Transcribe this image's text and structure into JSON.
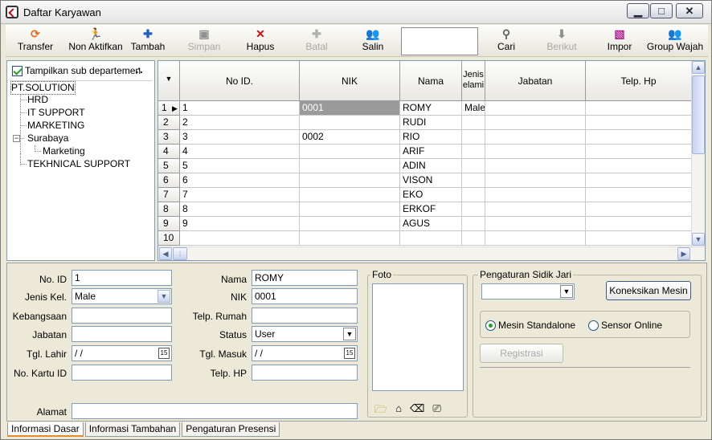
{
  "window": {
    "title": "Daftar Karyawan",
    "minimize": "▁",
    "maximize": "□",
    "close": "✕"
  },
  "toolbar": {
    "buttons": [
      {
        "label": "Transfer",
        "icon": "refresh-icon",
        "glyph": "⟳",
        "color": "#e07020",
        "enabled": true
      },
      {
        "label": "Non Aktifkan",
        "icon": "person-run-icon",
        "glyph": "🏃",
        "color": "#c03030",
        "enabled": true
      },
      {
        "label": "Tambah",
        "icon": "plus-icon",
        "glyph": "✚",
        "color": "#1f5fbf",
        "enabled": true
      },
      {
        "label": "Simpan",
        "icon": "save-icon",
        "glyph": "▣",
        "color": "#909090",
        "enabled": false
      },
      {
        "label": "Hapus",
        "icon": "delete-x-icon",
        "glyph": "✕",
        "color": "#d01010",
        "enabled": true
      },
      {
        "label": "Batal",
        "icon": "cancel-plus-icon",
        "glyph": "✚",
        "color": "#b0b0b0",
        "enabled": false
      },
      {
        "label": "Salin",
        "icon": "people-icon",
        "glyph": "👥",
        "color": "#c0a000",
        "enabled": true
      },
      {
        "label": "Cari",
        "icon": "search-bulb-icon",
        "glyph": "⚲",
        "color": "#606060",
        "enabled": true
      },
      {
        "label": "Berikut",
        "icon": "arrow-down-icon",
        "glyph": "⬇",
        "color": "#909090",
        "enabled": false
      },
      {
        "label": "Impor",
        "icon": "import-icon",
        "glyph": "▧",
        "color": "#b02090",
        "enabled": true
      },
      {
        "label": "Group Wajah",
        "icon": "group-face-icon",
        "glyph": "👥",
        "color": "#c0a000",
        "enabled": true
      }
    ],
    "search_value": ""
  },
  "tree": {
    "show_sub_label": "Tampilkan sub departemen",
    "show_sub_checked": true,
    "nodes": [
      {
        "label": "PT.SOLUTION"
      },
      {
        "label": "HRD"
      },
      {
        "label": "IT SUPPORT"
      },
      {
        "label": "MARKETING"
      },
      {
        "label": "Surabaya"
      },
      {
        "label": "Marketing"
      },
      {
        "label": "TEKHNICAL SUPPORT"
      }
    ]
  },
  "grid": {
    "columns": [
      "No ID.",
      "NIK",
      "Nama",
      "Jenis elami",
      "Jabatan",
      "Telp. Hp"
    ],
    "rows": [
      {
        "row": "1",
        "no_id": "1",
        "nik": "0001",
        "nama": "ROMY",
        "jenis": "Male",
        "jabatan": "",
        "telp": ""
      },
      {
        "row": "2",
        "no_id": "2",
        "nik": "",
        "nama": "RUDI",
        "jenis": "",
        "jabatan": "",
        "telp": ""
      },
      {
        "row": "3",
        "no_id": "3",
        "nik": "0002",
        "nama": "RIO",
        "jenis": "",
        "jabatan": "",
        "telp": ""
      },
      {
        "row": "4",
        "no_id": "4",
        "nik": "",
        "nama": "ARIF",
        "jenis": "",
        "jabatan": "",
        "telp": ""
      },
      {
        "row": "5",
        "no_id": "5",
        "nik": "",
        "nama": "ADIN",
        "jenis": "",
        "jabatan": "",
        "telp": ""
      },
      {
        "row": "6",
        "no_id": "6",
        "nik": "",
        "nama": "VISON",
        "jenis": "",
        "jabatan": "",
        "telp": ""
      },
      {
        "row": "7",
        "no_id": "7",
        "nik": "",
        "nama": "EKO",
        "jenis": "",
        "jabatan": "",
        "telp": ""
      },
      {
        "row": "8",
        "no_id": "8",
        "nik": "",
        "nama": "ERKOF",
        "jenis": "",
        "jabatan": "",
        "telp": ""
      },
      {
        "row": "9",
        "no_id": "9",
        "nik": "",
        "nama": "AGUS",
        "jenis": "",
        "jabatan": "",
        "telp": ""
      },
      {
        "row": "10",
        "no_id": "",
        "nik": "",
        "nama": "",
        "jenis": "",
        "jabatan": "",
        "telp": ""
      }
    ]
  },
  "form": {
    "no_id_label": "No. ID",
    "no_id": "1",
    "jenis_kel_label": "Jenis Kel.",
    "jenis_kel": "Male",
    "kebangsaan_label": "Kebangsaan",
    "kebangsaan": "",
    "jabatan_label": "Jabatan",
    "jabatan": "",
    "tgl_lahir_label": "Tgl. Lahir",
    "tgl_lahir": " / /",
    "no_kartu_label": "No. Kartu ID",
    "no_kartu": "",
    "alamat_label": "Alamat",
    "alamat": "",
    "nama_label": "Nama",
    "nama": "ROMY",
    "nik_label": "NIK",
    "nik": "0001",
    "telp_rumah_label": "Telp. Rumah",
    "telp_rumah": "",
    "status_label": "Status",
    "status": "User",
    "tgl_masuk_label": "Tgl. Masuk",
    "tgl_masuk": " / /",
    "telp_hp_label": "Telp. HP",
    "telp_hp": "",
    "cal_glyph": "15",
    "foto_label": "Foto"
  },
  "fingerprint": {
    "title": "Pengaturan Sidik Jari",
    "device_value": "",
    "connect_label": "Koneksikan Mesin",
    "standalone_label": "Mesin Standalone",
    "online_label": "Sensor Online",
    "standalone_selected": true,
    "register_label": "Registrasi"
  },
  "tabs": [
    "Informasi Dasar",
    "Informasi Tambahan",
    "Pengaturan Presensi"
  ],
  "active_tab": "Informasi Dasar"
}
